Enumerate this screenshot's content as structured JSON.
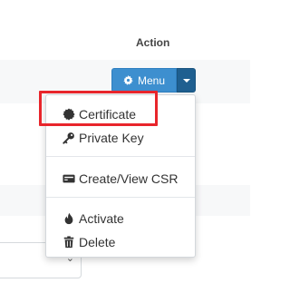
{
  "table": {
    "header": {
      "action_label": "Action"
    }
  },
  "action_menu": {
    "button_label": "Menu",
    "button_icon": "gear-icon",
    "toggle_icon": "caret-down-icon",
    "button_color": "#3d8fcf",
    "toggle_color": "#1f5f90",
    "items": [
      {
        "label": "Certificate",
        "icon": "certificate-icon"
      },
      {
        "label": "Private Key",
        "icon": "key-icon"
      },
      {
        "label": "Create/View CSR",
        "icon": "card-icon"
      },
      {
        "label": "Activate",
        "icon": "fire-icon"
      },
      {
        "label": "Delete",
        "icon": "trash-icon"
      }
    ],
    "highlighted_item": "Certificate",
    "highlight_color": "#e8252b"
  }
}
